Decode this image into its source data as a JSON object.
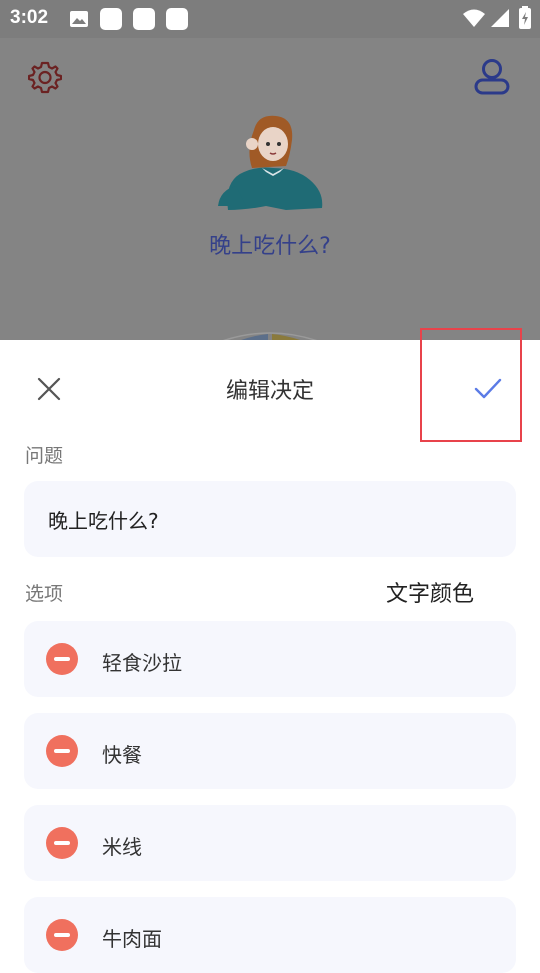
{
  "status_bar": {
    "time": "3:02",
    "icons": [
      "image-icon",
      "notification-square-icon",
      "notification-square-icon",
      "notification-square-icon",
      "wifi-icon",
      "signal-icon",
      "battery-icon"
    ]
  },
  "background": {
    "question": "晚上吃什么?",
    "colors": {
      "dim_overlay": "#848484",
      "gear": "#6b2222",
      "user": "#2b3a8a",
      "question_text": "#34408a"
    }
  },
  "sheet": {
    "title": "编辑决定",
    "question_section_label": "问题",
    "question_value": "晚上吃什么?",
    "options_section_label": "选项",
    "text_color_label": "文字颜色",
    "options": [
      {
        "label": "轻食沙拉"
      },
      {
        "label": "快餐"
      },
      {
        "label": "米线"
      },
      {
        "label": "牛肉面"
      }
    ],
    "colors": {
      "accent": "#5b7be6",
      "remove": "#f0705e",
      "field_background": "#f6f7fd",
      "highlight": "#e8434b"
    }
  }
}
